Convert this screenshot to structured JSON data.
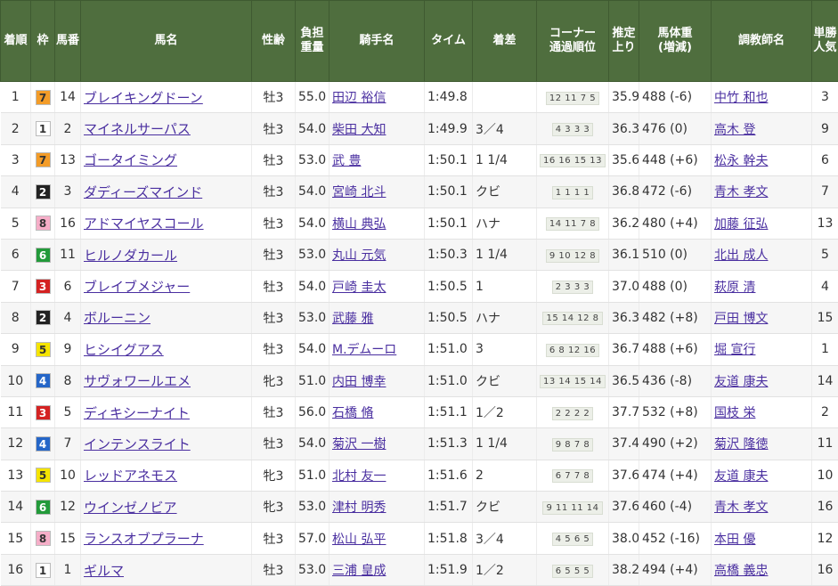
{
  "headers": {
    "rank": "着順",
    "waku": "枠",
    "umaban": "馬番",
    "horse": "馬名",
    "sex_age": "性齢",
    "weight": "負担重量",
    "jockey": "騎手名",
    "time": "タイム",
    "margin": "着差",
    "corner_line1": "コーナー",
    "corner_line2": "通過順位",
    "last3f": "推定上り",
    "body_line1": "馬体重",
    "body_line2": "(増減)",
    "trainer": "調教師名",
    "popularity": "単勝人気"
  },
  "waku_colors": {
    "1": {
      "bg": "#ffffff",
      "fg": "#333333"
    },
    "2": {
      "bg": "#222222",
      "fg": "#ffffff"
    },
    "3": {
      "bg": "#d42222",
      "fg": "#ffffff"
    },
    "4": {
      "bg": "#2566c8",
      "fg": "#ffffff"
    },
    "5": {
      "bg": "#f5e400",
      "fg": "#333333"
    },
    "6": {
      "bg": "#229a3a",
      "fg": "#ffffff"
    },
    "7": {
      "bg": "#f39c28",
      "fg": "#333333"
    },
    "8": {
      "bg": "#f6aec8",
      "fg": "#333333"
    }
  },
  "rows": [
    {
      "rank": "1",
      "waku": "7",
      "umaban": "14",
      "horse": "ブレイキングドーン",
      "sex_age": "牡3",
      "weight": "55.0",
      "jockey": "田辺 裕信",
      "time": "1:49.8",
      "margin": "",
      "corner": "12 11 7 5",
      "last3f": "35.9",
      "body": "488 (-6)",
      "trainer": "中竹 和也",
      "popularity": "3"
    },
    {
      "rank": "2",
      "waku": "1",
      "umaban": "2",
      "horse": "マイネルサーパス",
      "sex_age": "牡3",
      "weight": "54.0",
      "jockey": "柴田 大知",
      "time": "1:49.9",
      "margin": "3／4",
      "corner": "4 3 3 3",
      "last3f": "36.3",
      "body": "476 (0)",
      "trainer": "高木 登",
      "popularity": "9"
    },
    {
      "rank": "3",
      "waku": "7",
      "umaban": "13",
      "horse": "ゴータイミング",
      "sex_age": "牡3",
      "weight": "53.0",
      "jockey": "武 豊",
      "time": "1:50.1",
      "margin": "1 1/4",
      "corner": "16 16 15 13",
      "last3f": "35.6",
      "body": "448 (+6)",
      "trainer": "松永 幹夫",
      "popularity": "6"
    },
    {
      "rank": "4",
      "waku": "2",
      "umaban": "3",
      "horse": "ダディーズマインド",
      "sex_age": "牡3",
      "weight": "54.0",
      "jockey": "宮崎 北斗",
      "time": "1:50.1",
      "margin": "クビ",
      "corner": "1 1 1 1",
      "last3f": "36.8",
      "body": "472 (-6)",
      "trainer": "青木 孝文",
      "popularity": "7"
    },
    {
      "rank": "5",
      "waku": "8",
      "umaban": "16",
      "horse": "アドマイヤスコール",
      "sex_age": "牡3",
      "weight": "54.0",
      "jockey": "横山 典弘",
      "time": "1:50.1",
      "margin": "ハナ",
      "corner": "14 11 7 8",
      "last3f": "36.2",
      "body": "480 (+4)",
      "trainer": "加藤 征弘",
      "popularity": "13"
    },
    {
      "rank": "6",
      "waku": "6",
      "umaban": "11",
      "horse": "ヒルノダカール",
      "sex_age": "牡3",
      "weight": "53.0",
      "jockey": "丸山 元気",
      "time": "1:50.3",
      "margin": "1 1/4",
      "corner": "9 10 12 8",
      "last3f": "36.1",
      "body": "510 (0)",
      "trainer": "北出 成人",
      "popularity": "5"
    },
    {
      "rank": "7",
      "waku": "3",
      "umaban": "6",
      "horse": "ブレイブメジャー",
      "sex_age": "牡3",
      "weight": "54.0",
      "jockey": "戸崎 圭太",
      "time": "1:50.5",
      "margin": "1",
      "corner": "2 3 3 3",
      "last3f": "37.0",
      "body": "488 (0)",
      "trainer": "萩原 清",
      "popularity": "4"
    },
    {
      "rank": "8",
      "waku": "2",
      "umaban": "4",
      "horse": "ボルーニン",
      "sex_age": "牡3",
      "weight": "53.0",
      "jockey": "武藤 雅",
      "time": "1:50.5",
      "margin": "ハナ",
      "corner": "15 14 12 8",
      "last3f": "36.3",
      "body": "482 (+8)",
      "trainer": "戸田 博文",
      "popularity": "15"
    },
    {
      "rank": "9",
      "waku": "5",
      "umaban": "9",
      "horse": "ヒシイグアス",
      "sex_age": "牡3",
      "weight": "54.0",
      "jockey": "M.デムーロ",
      "time": "1:51.0",
      "margin": "3",
      "corner": "6 8 12 16",
      "last3f": "36.7",
      "body": "488 (+6)",
      "trainer": "堀 宣行",
      "popularity": "1"
    },
    {
      "rank": "10",
      "waku": "4",
      "umaban": "8",
      "horse": "サヴォワールエメ",
      "sex_age": "牝3",
      "weight": "51.0",
      "jockey": "内田 博幸",
      "time": "1:51.0",
      "margin": "クビ",
      "corner": "13 14 15 14",
      "last3f": "36.5",
      "body": "436 (-8)",
      "trainer": "友道 康夫",
      "popularity": "14"
    },
    {
      "rank": "11",
      "waku": "3",
      "umaban": "5",
      "horse": "ディキシーナイト",
      "sex_age": "牡3",
      "weight": "56.0",
      "jockey": "石橋 脩",
      "time": "1:51.1",
      "margin": "1／2",
      "corner": "2 2 2 2",
      "last3f": "37.7",
      "body": "532 (+8)",
      "trainer": "国枝 栄",
      "popularity": "2"
    },
    {
      "rank": "12",
      "waku": "4",
      "umaban": "7",
      "horse": "インテンスライト",
      "sex_age": "牡3",
      "weight": "54.0",
      "jockey": "菊沢 一樹",
      "time": "1:51.3",
      "margin": "1 1/4",
      "corner": "9 8 7 8",
      "last3f": "37.4",
      "body": "490 (+2)",
      "trainer": "菊沢 隆徳",
      "popularity": "11"
    },
    {
      "rank": "13",
      "waku": "5",
      "umaban": "10",
      "horse": "レッドアネモス",
      "sex_age": "牝3",
      "weight": "51.0",
      "jockey": "北村 友一",
      "time": "1:51.6",
      "margin": "2",
      "corner": "6 7 7 8",
      "last3f": "37.6",
      "body": "474 (+4)",
      "trainer": "友道 康夫",
      "popularity": "10"
    },
    {
      "rank": "14",
      "waku": "6",
      "umaban": "12",
      "horse": "ウインゼノビア",
      "sex_age": "牝3",
      "weight": "53.0",
      "jockey": "津村 明秀",
      "time": "1:51.7",
      "margin": "クビ",
      "corner": "9 11 11 14",
      "last3f": "37.6",
      "body": "460 (-4)",
      "trainer": "青木 孝文",
      "popularity": "16"
    },
    {
      "rank": "15",
      "waku": "8",
      "umaban": "15",
      "horse": "ランスオブプラーナ",
      "sex_age": "牡3",
      "weight": "57.0",
      "jockey": "松山 弘平",
      "time": "1:51.8",
      "margin": "3／4",
      "corner": "4 5 6 5",
      "last3f": "38.0",
      "body": "452 (-16)",
      "trainer": "本田 優",
      "popularity": "12"
    },
    {
      "rank": "16",
      "waku": "1",
      "umaban": "1",
      "horse": "ギルマ",
      "sex_age": "牡3",
      "weight": "53.0",
      "jockey": "三浦 皇成",
      "time": "1:51.9",
      "margin": "1／2",
      "corner": "6 5 5 5",
      "last3f": "38.2",
      "body": "494 (+4)",
      "trainer": "高橋 義忠",
      "popularity": "16"
    }
  ]
}
